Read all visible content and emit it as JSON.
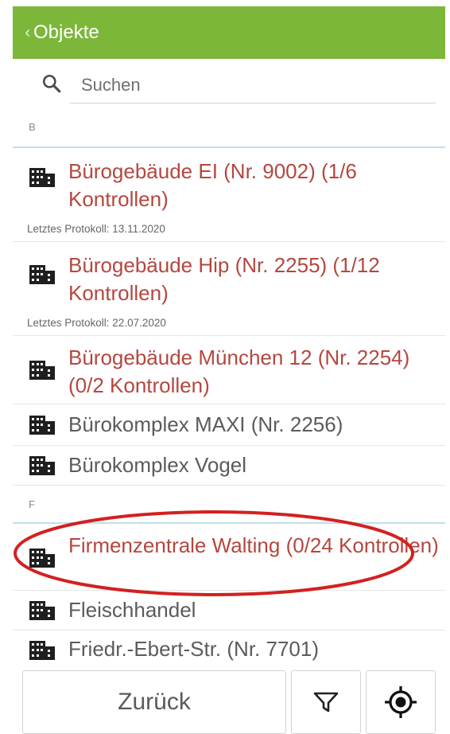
{
  "header": {
    "title": "Objekte",
    "back_icon": "chevron-left-icon",
    "color": "#7cb73a"
  },
  "search": {
    "placeholder": "Suchen",
    "value": ""
  },
  "sections": [
    {
      "letter": "B",
      "items": [
        {
          "title": "Bürogebäude EI (Nr. 9002) (1/6 Kontrollen)",
          "status": "pending",
          "protocol": "Letztes Protokoll: 13.11.2020"
        },
        {
          "title": "Bürogebäude Hip (Nr. 2255) (1/12 Kontrollen)",
          "status": "pending",
          "protocol": "Letztes Protokoll: 22.07.2020"
        },
        {
          "title": "Bürogebäude München 12 (Nr. 2254) (0/2 Kontrollen)",
          "status": "pending"
        },
        {
          "title": "Bürokomplex MAXI (Nr. 2256)",
          "status": "none"
        },
        {
          "title": "Bürokomplex Vogel",
          "status": "none"
        }
      ]
    },
    {
      "letter": "F",
      "items": [
        {
          "title": "Firmenzentrale Walting (0/24 Kontrollen)",
          "status": "pending",
          "highlighted": true
        },
        {
          "title": "Fleischhandel",
          "status": "none"
        },
        {
          "title": "Friedr.-Ebert-Str. (Nr. 7701)",
          "status": "none"
        }
      ]
    }
  ],
  "footer": {
    "back_label": "Zurück",
    "filter_icon": "filter-icon",
    "location_icon": "locate-icon"
  },
  "colors": {
    "pending": "#b4473f",
    "none": "#5b5b5b",
    "annotation": "#d42020"
  }
}
